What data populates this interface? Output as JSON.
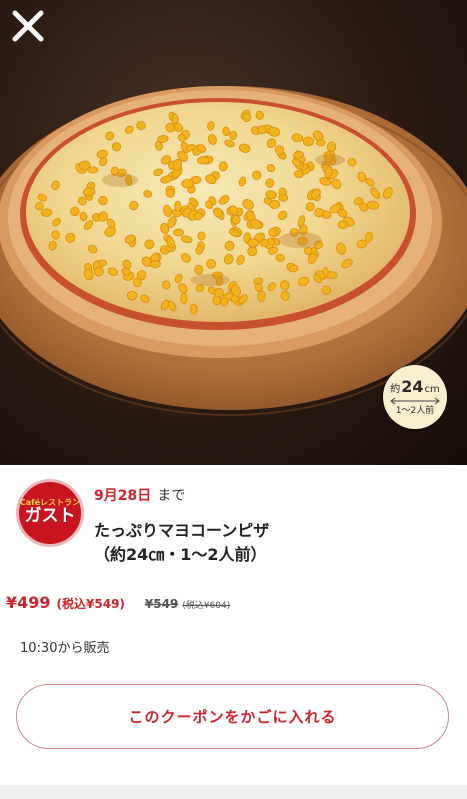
{
  "hero": {
    "image_label": "pizza-photo",
    "close_icon": "close-icon",
    "size_badge": {
      "prefix": "約",
      "size": "24",
      "unit": "cm",
      "servings": "1〜2人前"
    }
  },
  "shop": {
    "logo_top": "Caféレストラン",
    "logo_main": "ガスト",
    "brand_color": "#c8141e"
  },
  "coupon": {
    "deadline_date": "9月28日",
    "deadline_suffix": "まで",
    "title_line1": "たっぷりマヨコーンピザ",
    "title_line2": "（約24㎝・1〜2人前）",
    "price": "¥499",
    "price_tax": "(税込¥549)",
    "original_price": "¥549",
    "original_price_tax": "(税込¥604)",
    "sale_time": "10:30から販売",
    "cart_button": "このクーポンをかごに入れる",
    "accent_color": "#d0242c"
  }
}
